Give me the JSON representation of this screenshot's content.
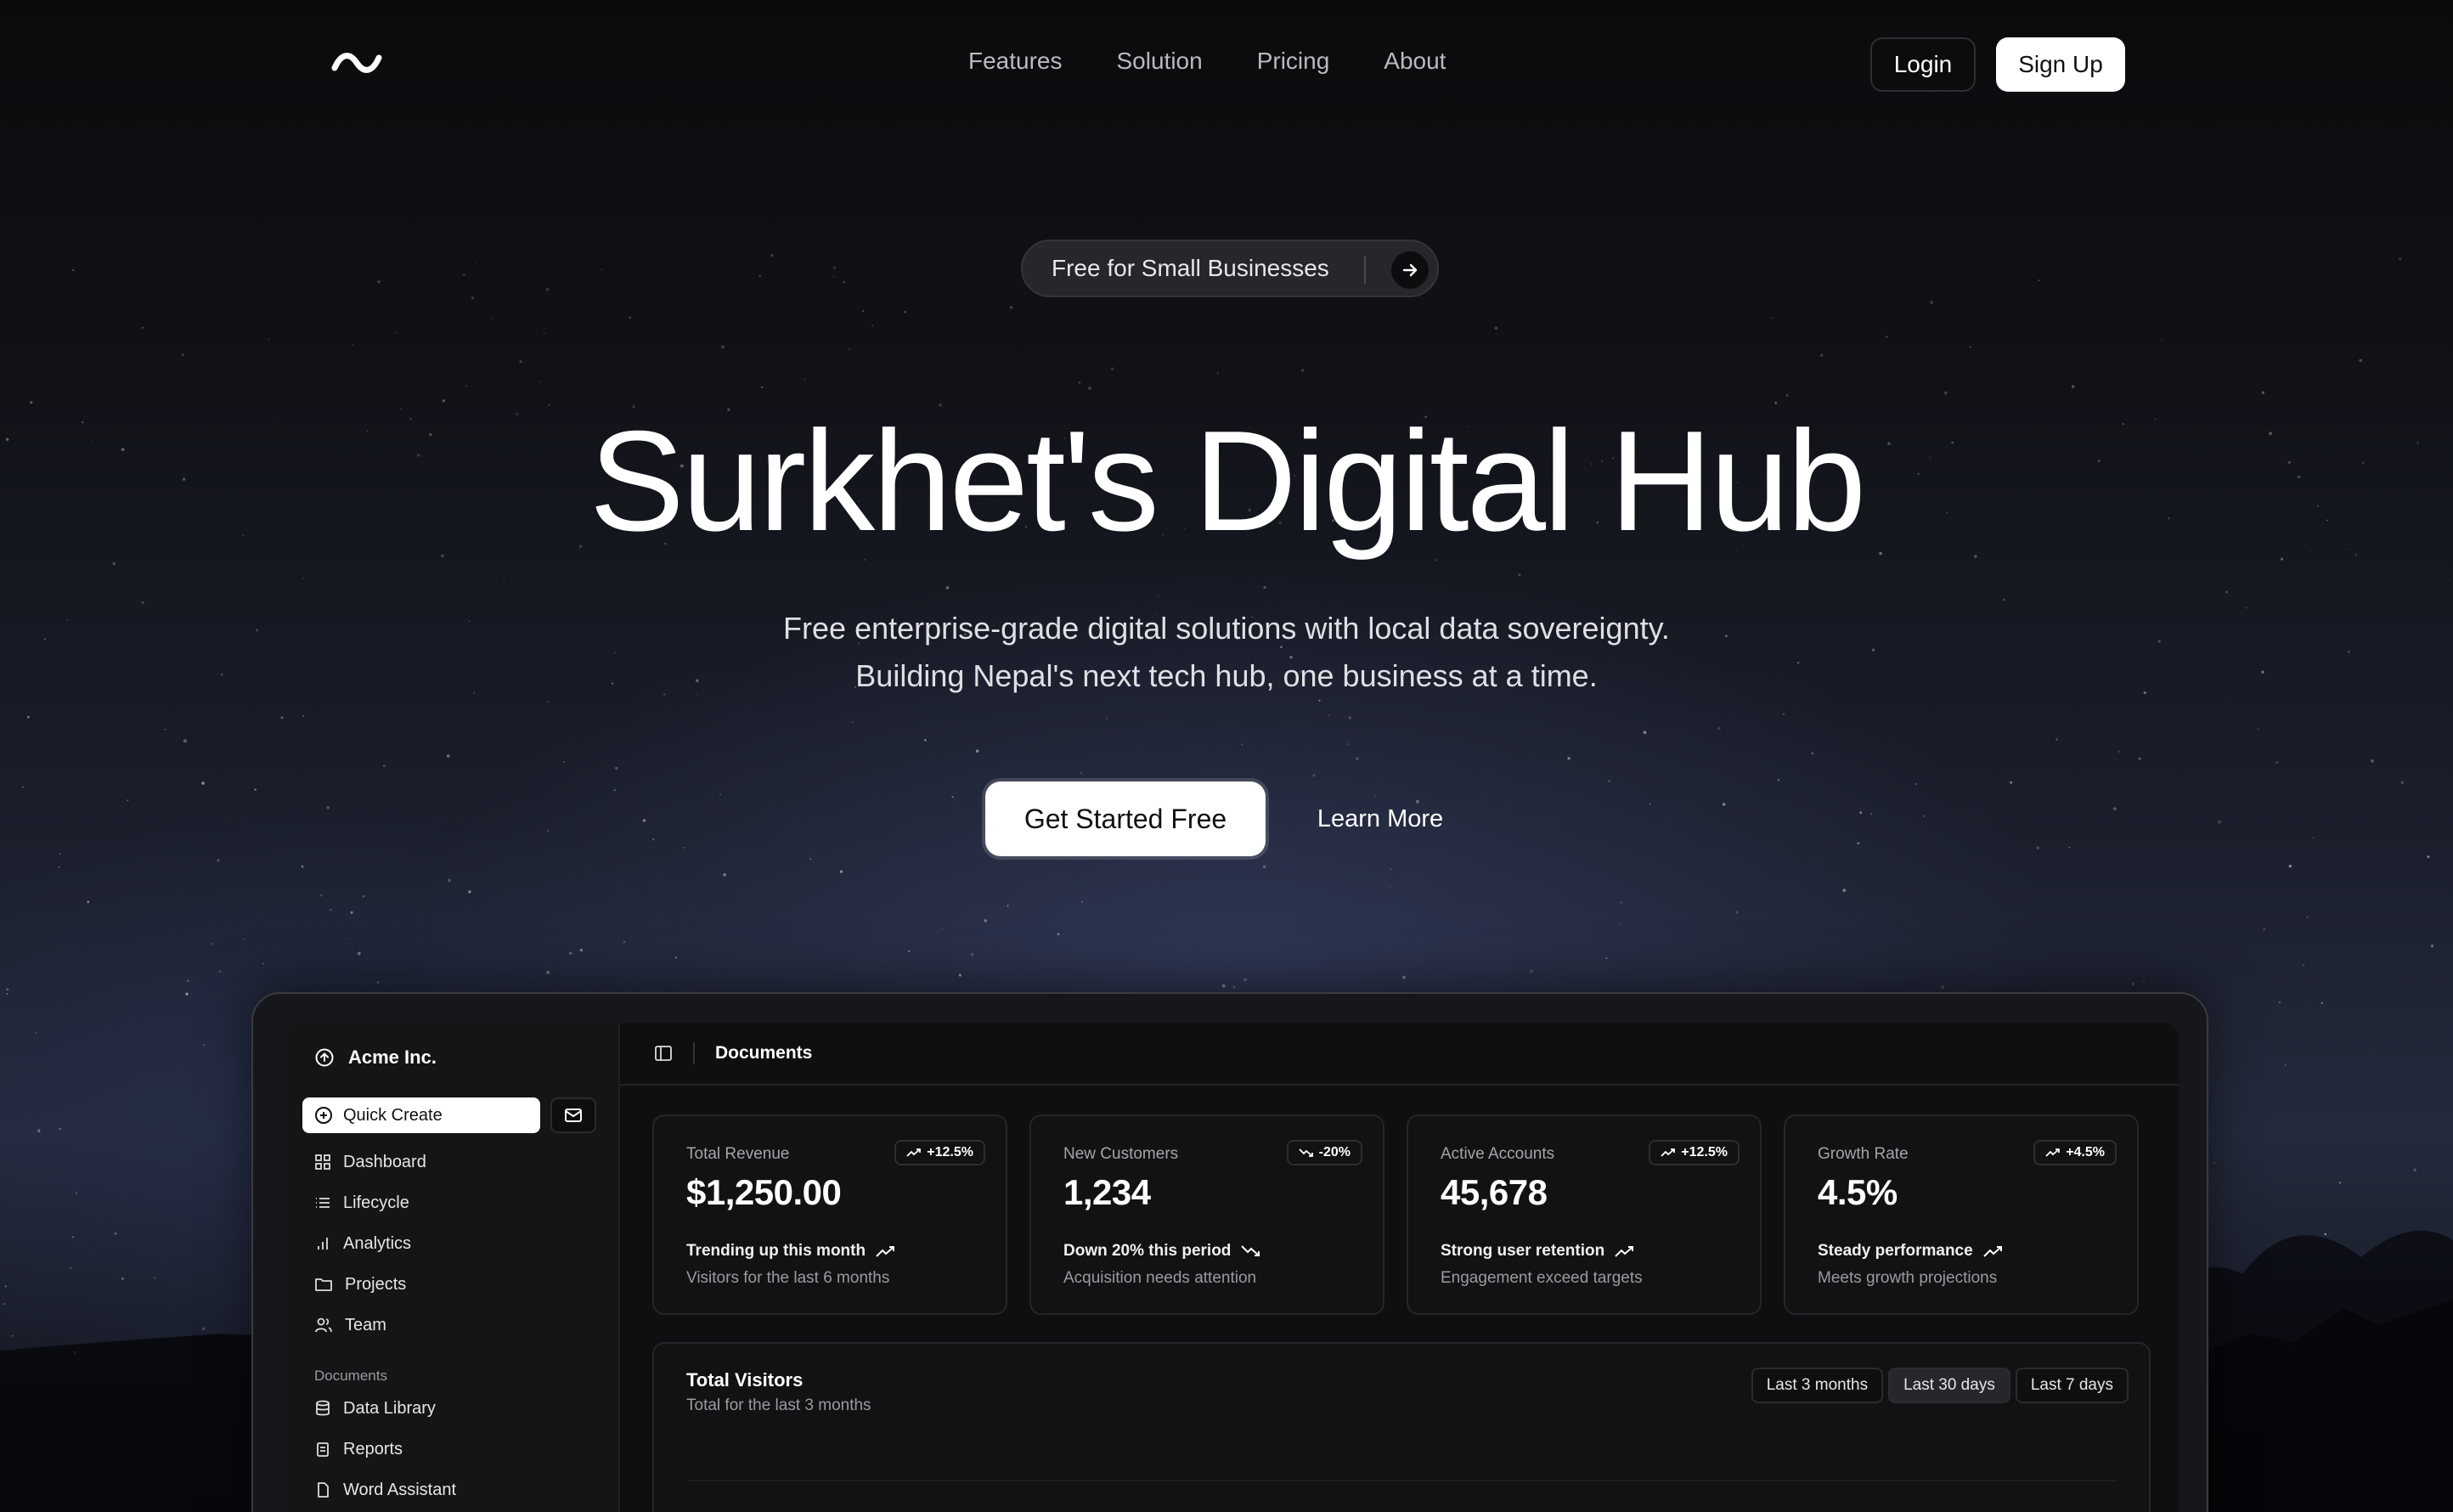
{
  "nav": {
    "links": [
      "Features",
      "Solution",
      "Pricing",
      "About"
    ],
    "login": "Login",
    "signup": "Sign Up",
    "logo_icon": "tilde-wave-logo"
  },
  "hero": {
    "pill_text": "Free for Small Businesses",
    "title": "Surkhet's Digital Hub",
    "subtitle_line1": "Free enterprise-grade digital solutions with local data sovereignty.",
    "subtitle_line2": "Building Nepal's next tech hub, one business at a time.",
    "cta_primary": "Get Started Free",
    "cta_secondary": "Learn More"
  },
  "dashboard": {
    "brand": "Acme Inc.",
    "quick_create": "Quick Create",
    "menu": [
      {
        "label": "Dashboard",
        "icon": "dashboard-icon"
      },
      {
        "label": "Lifecycle",
        "icon": "list-icon"
      },
      {
        "label": "Analytics",
        "icon": "bar-chart-icon"
      },
      {
        "label": "Projects",
        "icon": "folder-icon"
      },
      {
        "label": "Team",
        "icon": "users-icon"
      }
    ],
    "documents_label": "Documents",
    "documents_menu": [
      {
        "label": "Data Library",
        "icon": "database-icon"
      },
      {
        "label": "Reports",
        "icon": "clipboard-icon"
      },
      {
        "label": "Word Assistant",
        "icon": "file-icon"
      }
    ],
    "page_title": "Documents",
    "cards": [
      {
        "label": "Total Revenue",
        "badge": "+12.5%",
        "trend": "up",
        "value": "$1,250.00",
        "foot1": "Trending up this month",
        "foot2": "Visitors for the last 6 months"
      },
      {
        "label": "New Customers",
        "badge": "-20%",
        "trend": "down",
        "value": "1,234",
        "foot1": "Down 20% this period",
        "foot2": "Acquisition needs attention"
      },
      {
        "label": "Active Accounts",
        "badge": "+12.5%",
        "trend": "up",
        "value": "45,678",
        "foot1": "Strong user retention",
        "foot2": "Engagement exceed targets"
      },
      {
        "label": "Growth Rate",
        "badge": "+4.5%",
        "trend": "up",
        "value": "4.5%",
        "foot1": "Steady performance",
        "foot2": "Meets growth projections"
      }
    ],
    "visitors": {
      "title": "Total Visitors",
      "subtitle": "Total for the last 3 months",
      "ranges": [
        "Last 3 months",
        "Last 30 days",
        "Last 7 days"
      ],
      "active_range": "Last 30 days"
    }
  },
  "colors": {
    "background_top": "#0b0b0d",
    "background_sky": "#242a3d",
    "primary_button": "#ffffff",
    "panel": "#121214"
  }
}
